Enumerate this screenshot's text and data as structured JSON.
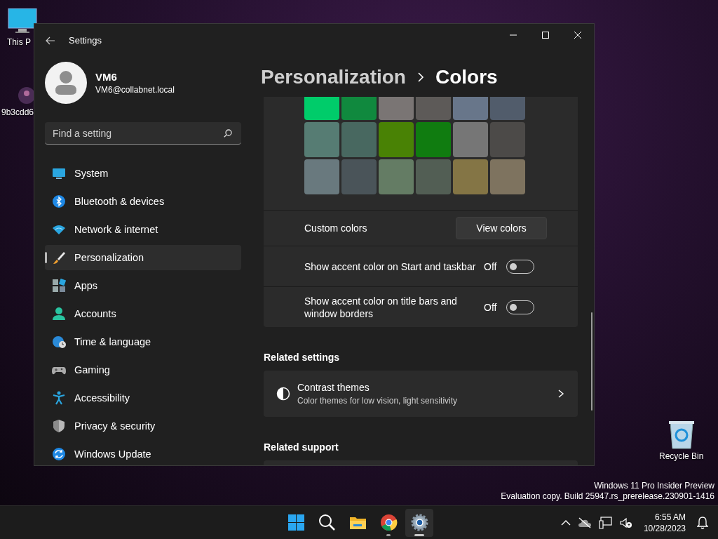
{
  "desktop_icons": [
    {
      "label": "This P"
    },
    {
      "label": "9b3cdd6"
    },
    {
      "label": "Recycle Bin"
    }
  ],
  "window": {
    "title": "Settings"
  },
  "account": {
    "name": "VM6",
    "email": "VM6@collabnet.local"
  },
  "search": {
    "placeholder": "Find a setting"
  },
  "nav": [
    {
      "label": "System",
      "selected": false
    },
    {
      "label": "Bluetooth & devices",
      "selected": false
    },
    {
      "label": "Network & internet",
      "selected": false
    },
    {
      "label": "Personalization",
      "selected": true
    },
    {
      "label": "Apps",
      "selected": false
    },
    {
      "label": "Accounts",
      "selected": false
    },
    {
      "label": "Time & language",
      "selected": false
    },
    {
      "label": "Gaming",
      "selected": false
    },
    {
      "label": "Accessibility",
      "selected": false
    },
    {
      "label": "Privacy & security",
      "selected": false
    },
    {
      "label": "Windows Update",
      "selected": false
    }
  ],
  "breadcrumb": [
    "Personalization",
    "Colors"
  ],
  "swatches": [
    {
      "color": "#00cc6a"
    },
    {
      "color": "#10893e"
    },
    {
      "color": "#7a7574"
    },
    {
      "color": "#5d5a58"
    },
    {
      "color": "#68768a"
    },
    {
      "color": "#515c6b"
    },
    {
      "color": "#567c73"
    },
    {
      "color": "#486860"
    },
    {
      "color": "#498205"
    },
    {
      "color": "#107c10"
    },
    {
      "color": "#767676"
    },
    {
      "color": "#4c4a48"
    },
    {
      "color": "#69797e"
    },
    {
      "color": "#4a5459"
    },
    {
      "color": "#647c64"
    },
    {
      "color": "#525e54"
    },
    {
      "color": "#847545"
    },
    {
      "color": "#7e735f"
    }
  ],
  "settings_rows": [
    {
      "kind": "button",
      "label": "Custom colors",
      "button": "View colors"
    },
    {
      "kind": "toggle",
      "label": "Show accent color on Start and taskbar",
      "state_text": "Off",
      "on": false
    },
    {
      "kind": "toggle",
      "label": "Show accent color on title bars and window borders",
      "state_text": "Off",
      "on": false
    }
  ],
  "related_settings": {
    "heading": "Related settings",
    "items": [
      {
        "title": "Contrast themes",
        "description": "Color themes for low vision, light sensitivity"
      }
    ]
  },
  "related_support": {
    "heading": "Related support"
  },
  "system_notice": [
    "Windows 11 Pro Insider Preview",
    "Evaluation copy. Build 25947.rs_prerelease.230901-1416"
  ],
  "taskbar": {
    "apps": [
      {
        "running": false,
        "active": false
      },
      {
        "running": false,
        "active": false
      },
      {
        "running": false,
        "active": false
      },
      {
        "running": true,
        "active": false
      },
      {
        "running": true,
        "active": true
      }
    ]
  },
  "clock": {
    "time": "6:55 AM",
    "date": "10/28/2023"
  }
}
